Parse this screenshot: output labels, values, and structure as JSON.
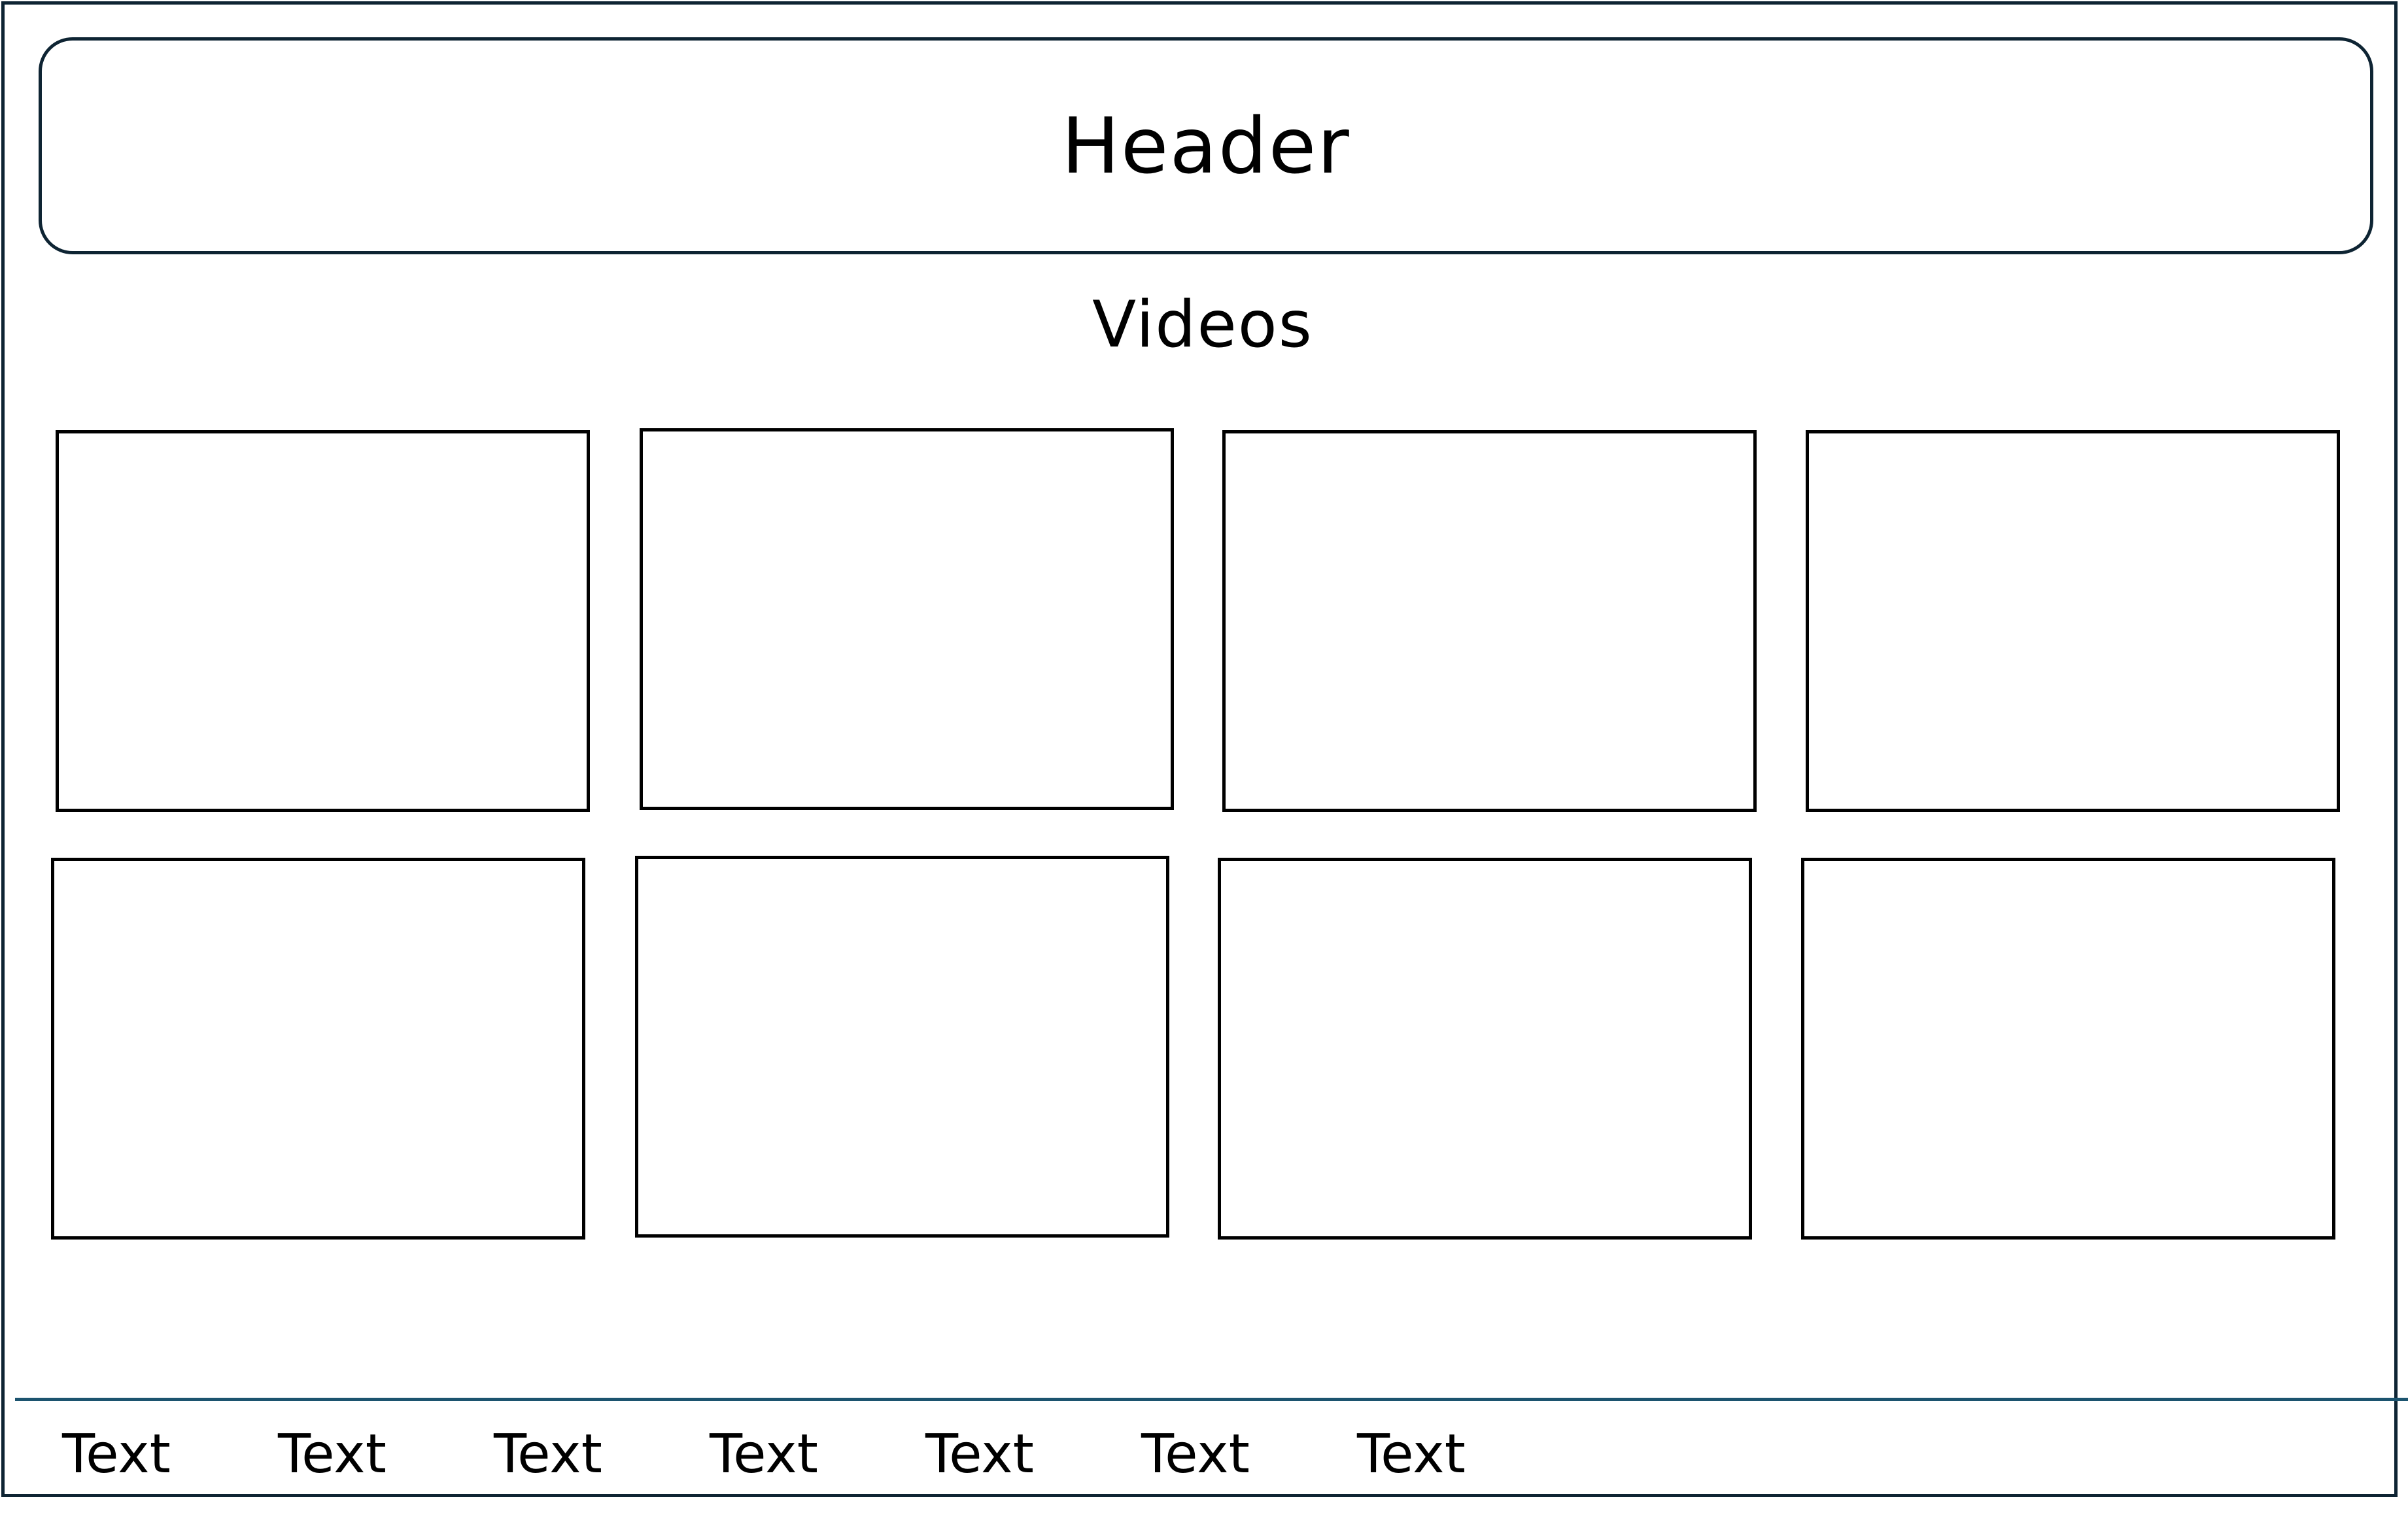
{
  "header": {
    "title": "Header"
  },
  "main": {
    "section_title": "Videos",
    "video_tiles": [
      {},
      {},
      {},
      {},
      {},
      {},
      {},
      {}
    ]
  },
  "footer": {
    "links": [
      "Text",
      "Text",
      "Text",
      "Text",
      "Text",
      "Text",
      "Text"
    ]
  },
  "colors": {
    "frame_border": "#0e2433",
    "footer_divider": "#1c546f",
    "tile_border": "#000000",
    "background": "#ffffff"
  }
}
